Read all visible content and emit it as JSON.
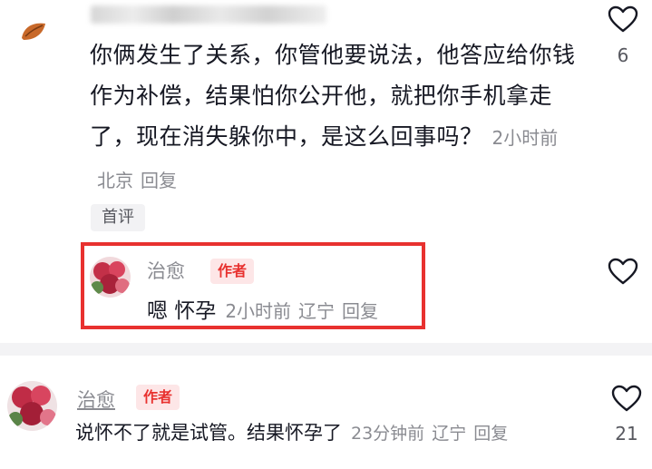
{
  "top_comment": {
    "text": "你俩发生了关系，你管他要说法，他答应给你钱作为补偿，结果怕你公开他，就把你手机拿走了，现在消失躲你中，是这么回事吗？",
    "time": "2小时前",
    "location": "北京",
    "reply_label": "回复",
    "likes": "6",
    "pin_label": "首评"
  },
  "author_reply": {
    "name": "治愈",
    "badge": "作者",
    "text": "嗯 怀孕",
    "time": "2小时前",
    "location": "辽宁",
    "reply_label": "回复"
  },
  "bottom_comment": {
    "name": "治愈",
    "badge": "作者",
    "text": "说怀不了就是试管。结果怀孕了",
    "time": "23分钟前",
    "location": "辽宁",
    "reply_label": "回复",
    "likes": "21"
  },
  "colors": {
    "highlight": "#e8312f",
    "author_badge_bg": "#fde6e7",
    "meta_text": "#8a8b91"
  },
  "icons": [
    "heart-outline-icon",
    "leaf-avatar-icon"
  ]
}
